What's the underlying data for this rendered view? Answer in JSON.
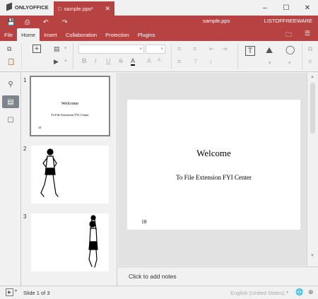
{
  "app": {
    "name": "ONLYOFFICE",
    "tab_title": "sample.pps*",
    "doc_title": "sample.pps",
    "user": "LISTOFFREEWARE"
  },
  "menu": {
    "tabs": [
      "File",
      "Home",
      "Insert",
      "Collaboration",
      "Protection",
      "Plugins"
    ],
    "active": "Home"
  },
  "slides": {
    "items": [
      {
        "num": "1",
        "title": "Welcome",
        "subtitle": "To File Extension FYI Center",
        "page_num": "18"
      },
      {
        "num": "2",
        "figure": "runner"
      },
      {
        "num": "3",
        "figure": "basketball-player"
      }
    ],
    "selected": "1"
  },
  "main_slide": {
    "title": "Welcome",
    "subtitle": "To File Extension FYI Center",
    "page_num": "18"
  },
  "notes": {
    "placeholder": "Click to add notes"
  },
  "status": {
    "slide_count": "Slide 1 of 3",
    "language": "English (United States)"
  }
}
